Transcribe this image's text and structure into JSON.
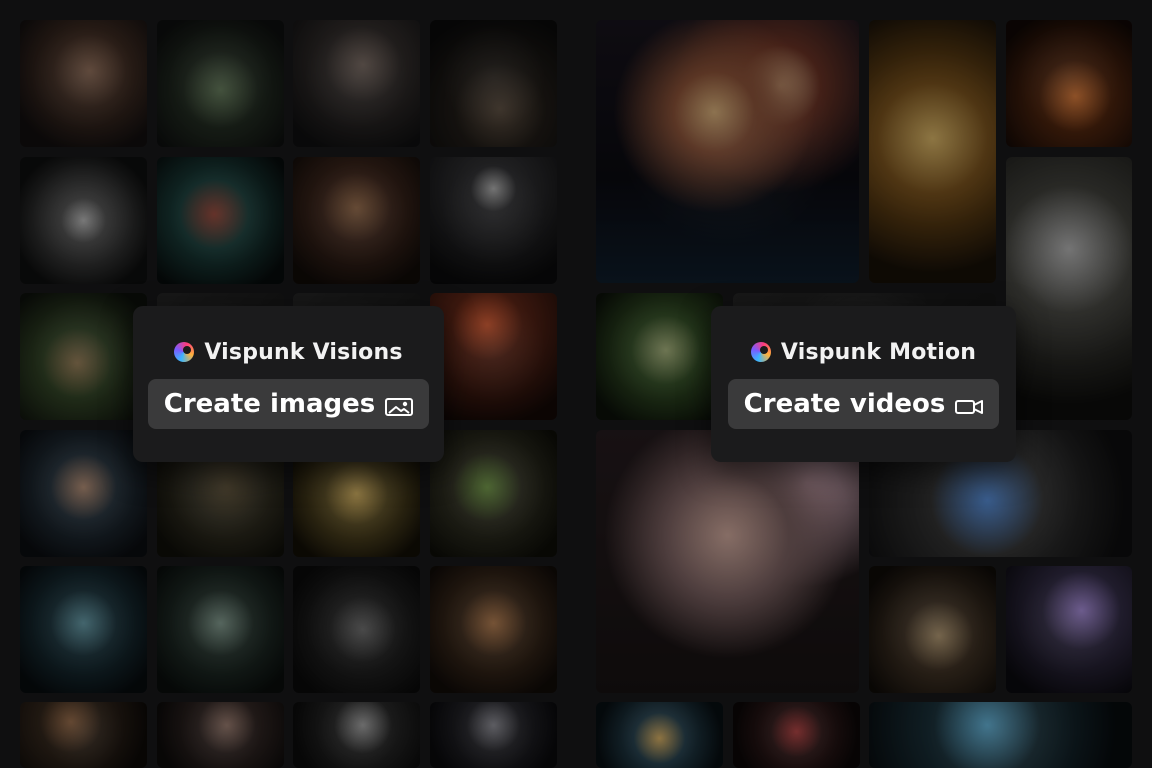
{
  "colors": {
    "background": "#0f0f10",
    "overlay_card": "#1b1b1c",
    "button_bg": "#3a3a3b",
    "text": "#ffffff"
  },
  "cards": [
    {
      "brand": "Vispunk Visions",
      "cta_label": "Create images",
      "cta_icon": "image-icon"
    },
    {
      "brand": "Vispunk Motion",
      "cta_label": "Create videos",
      "cta_icon": "video-camera-icon"
    }
  ],
  "gallery_left": [
    {
      "name": "gallery-tile-portrait-woman",
      "c1": "#6b4a3a",
      "c2": "#1a120e"
    },
    {
      "name": "gallery-tile-salad-glass-bowl",
      "c1": "#3a4a3a",
      "c2": "#111511"
    },
    {
      "name": "gallery-tile-portrait-man",
      "c1": "#3f3f42",
      "c2": "#121214"
    },
    {
      "name": "gallery-tile-mountain-night-sky",
      "c1": "#2a2520",
      "c2": "#0b0b0b"
    },
    {
      "name": "gallery-tile-white-flower",
      "c1": "#4a4a4a",
      "c2": "#0f1010"
    },
    {
      "name": "gallery-tile-mushrooms",
      "c1": "#1f4a46",
      "c2": "#070c0c"
    },
    {
      "name": "gallery-tile-alien-diner",
      "c1": "#5a3c2a",
      "c2": "#120c08"
    },
    {
      "name": "gallery-tile-moon-beach",
      "c1": "#2c2c30",
      "c2": "#0b0b0c"
    },
    {
      "name": "gallery-tile-snail",
      "c1": "#3a4f2c",
      "c2": "#0e120c"
    },
    {
      "name": "gallery-tile-hidden-1",
      "c1": "#2a2a2a",
      "c2": "#111"
    },
    {
      "name": "gallery-tile-hidden-2",
      "c1": "#2a2a2a",
      "c2": "#111"
    },
    {
      "name": "gallery-tile-volcano-explorer",
      "c1": "#6b2b1a",
      "c2": "#160906"
    },
    {
      "name": "gallery-tile-astronaut-child",
      "c1": "#2b3a46",
      "c2": "#0b0e12"
    },
    {
      "name": "gallery-tile-biker-forest",
      "c1": "#3e3a2a",
      "c2": "#101009"
    },
    {
      "name": "gallery-tile-duckling",
      "c1": "#6a5a2a",
      "c2": "#141006"
    },
    {
      "name": "gallery-tile-dragon-stroller",
      "c1": "#3a3a2a",
      "c2": "#0f0f08"
    },
    {
      "name": "gallery-tile-underwater-bed",
      "c1": "#1f3b45",
      "c2": "#070c0f"
    },
    {
      "name": "gallery-tile-octopus-creature",
      "c1": "#2a3a33",
      "c2": "#0a0f0d"
    },
    {
      "name": "gallery-tile-godzilla-toy",
      "c1": "#2a2a2a",
      "c2": "#0a0a0a"
    },
    {
      "name": "gallery-tile-corgi-batman",
      "c1": "#4a3422",
      "c2": "#120c08"
    },
    {
      "name": "gallery-tile-dog-partial",
      "c1": "#3a2c20",
      "c2": "#0f0b08"
    },
    {
      "name": "gallery-tile-woman-window",
      "c1": "#3a2d2a",
      "c2": "#0f0c0b"
    },
    {
      "name": "gallery-tile-room-interior",
      "c1": "#2f2f2f",
      "c2": "#0c0c0c"
    },
    {
      "name": "gallery-tile-robot-portrait",
      "c1": "#2c2c32",
      "c2": "#0a0a0d"
    }
  ],
  "gallery_right": [
    {
      "name": "gallery-tile-fireworks",
      "c1": "#6a3a2a",
      "c2": "#0b0b12"
    },
    {
      "name": "gallery-tile-autumn-leaves",
      "c1": "#8a5a1a",
      "c2": "#1a1208"
    },
    {
      "name": "gallery-tile-campfire",
      "c1": "#5a2a10",
      "c2": "#120805"
    },
    {
      "name": "gallery-tile-droids-forest",
      "c1": "#4a4a44",
      "c2": "#0f0f0d"
    },
    {
      "name": "gallery-tile-fairies",
      "c1": "#3a5a2a",
      "c2": "#0c1209"
    },
    {
      "name": "gallery-tile-hidden-3",
      "c1": "#2a2a2a",
      "c2": "#111"
    },
    {
      "name": "gallery-tile-smiling-girl-blossoms",
      "c1": "#8a6a6a",
      "c2": "#1a1414"
    },
    {
      "name": "gallery-tile-blue-dragon-road",
      "c1": "#3a3a3a",
      "c2": "#0f0f10"
    },
    {
      "name": "gallery-tile-diner-scene",
      "c1": "#4a3a2a",
      "c2": "#100c08"
    },
    {
      "name": "gallery-tile-comet-lake",
      "c1": "#3a3350",
      "c2": "#0b0a10"
    },
    {
      "name": "gallery-tile-burger-sea",
      "c1": "#2a4a5a",
      "c2": "#081014"
    },
    {
      "name": "gallery-tile-christmas-ornaments",
      "c1": "#3a1f1f",
      "c2": "#0c0707"
    },
    {
      "name": "gallery-tile-underwater-room",
      "c1": "#1f3a45",
      "c2": "#070c0f"
    }
  ]
}
